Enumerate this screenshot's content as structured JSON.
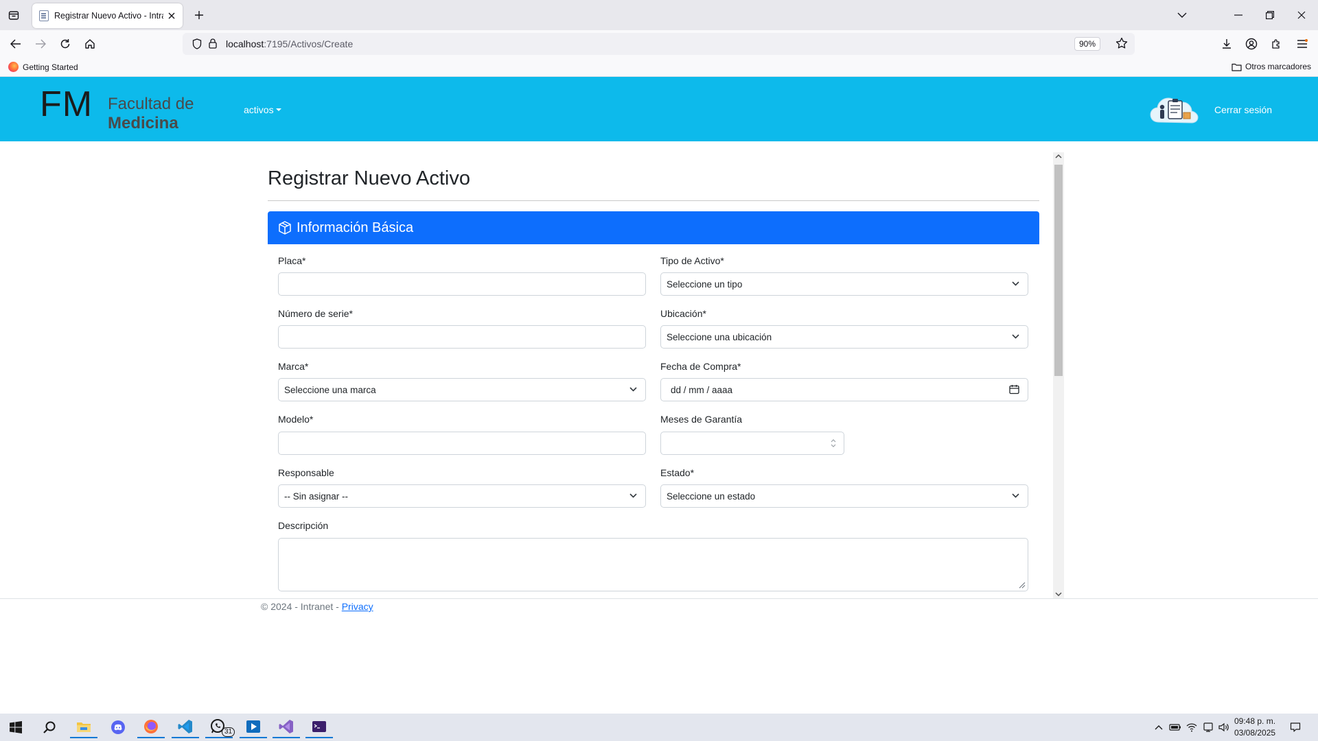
{
  "browser": {
    "tab_title": "Registrar Nuevo Activo - Intranet",
    "url_host": "localhost",
    "url_path": ":7195/Activos/Create",
    "zoom": "90%",
    "bookmark_getting_started": "Getting Started",
    "bookmark_other": "Otros marcadores"
  },
  "header": {
    "logo_initials": "FM",
    "logo_line1": "Facultad de",
    "logo_line2": "Medicina",
    "nav_activos": "activos",
    "logout": "Cerrar sesión"
  },
  "page": {
    "title": "Registrar Nuevo Activo",
    "section_title": "Información Básica"
  },
  "form": {
    "placa_label": "Placa*",
    "tipo_label": "Tipo de Activo*",
    "tipo_value": "Seleccione un tipo",
    "serie_label": "Número de serie*",
    "ubicacion_label": "Ubicación*",
    "ubicacion_value": "Seleccione una ubicación",
    "marca_label": "Marca*",
    "marca_value": "Seleccione una marca",
    "fecha_label": "Fecha de Compra*",
    "fecha_placeholder": "dd / mm / aaaa",
    "modelo_label": "Modelo*",
    "garantia_label": "Meses de Garantía",
    "responsable_label": "Responsable",
    "responsable_value": "-- Sin asignar --",
    "estado_label": "Estado*",
    "estado_value": "Seleccione un estado",
    "descripcion_label": "Descripción"
  },
  "footer": {
    "copyright": "© 2024 - Intranet - ",
    "privacy": "Privacy"
  },
  "taskbar": {
    "whatsapp_badge": "31",
    "time": "09:48 p. m.",
    "date": "03/08/2025"
  },
  "colors": {
    "site_header": "#0dbaeb",
    "card_header": "#0d6efd",
    "link": "#0d6efd"
  }
}
